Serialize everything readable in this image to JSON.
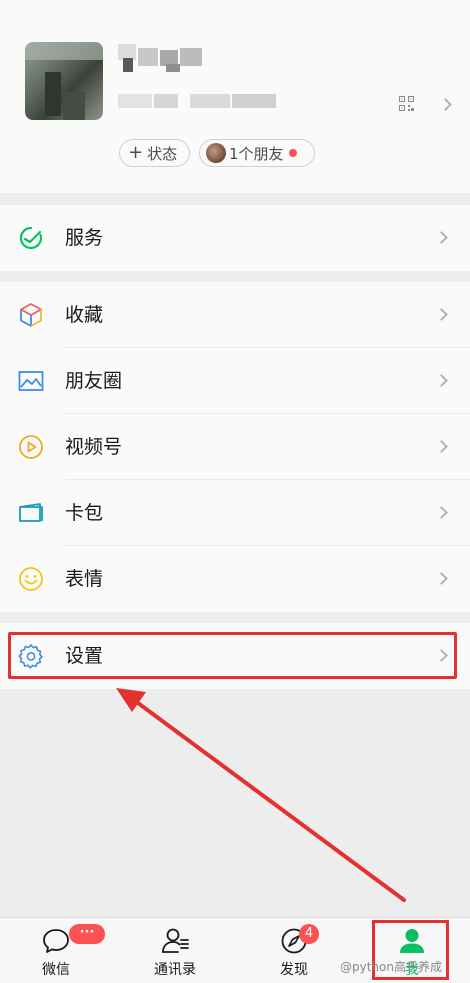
{
  "profile": {
    "status_label": "状态",
    "status_plus": "+",
    "friends_label": "1个朋友"
  },
  "menu": {
    "services": "服务",
    "favorites": "收藏",
    "moments": "朋友圈",
    "channels": "视频号",
    "cards": "卡包",
    "stickers": "表情",
    "settings": "设置"
  },
  "tabs": [
    {
      "label": "微信",
      "badge": "···"
    },
    {
      "label": "通讯录"
    },
    {
      "label": "发现",
      "badge": "4"
    },
    {
      "label": "我"
    }
  ],
  "watermark": "@python高手养成",
  "colors": {
    "accent_green": "#07c160",
    "badge_red": "#fa5151",
    "annotation_red": "#e53030"
  }
}
